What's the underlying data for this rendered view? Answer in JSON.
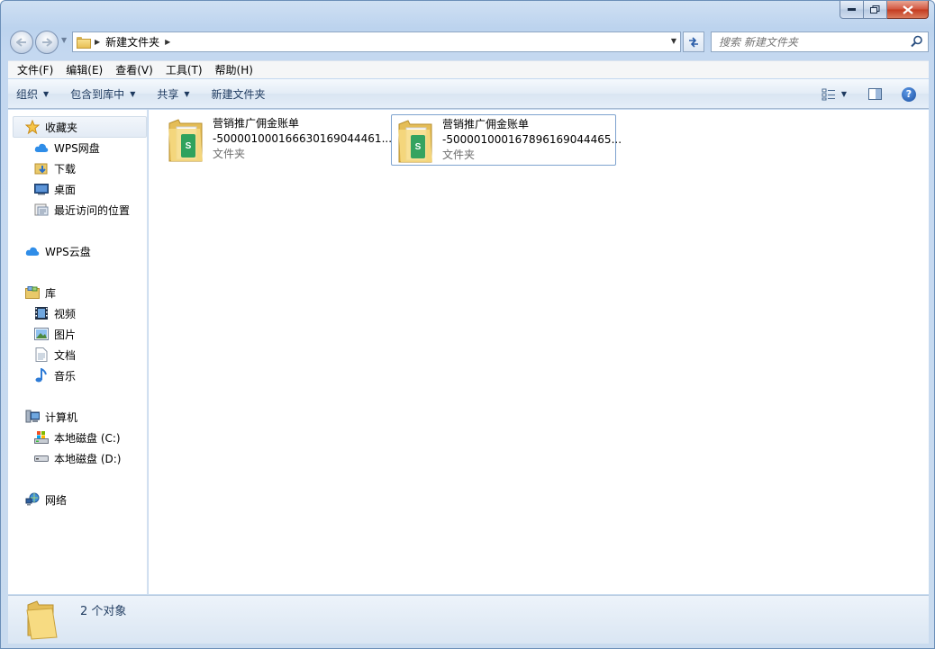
{
  "window": {
    "caption": {
      "minimize": "—",
      "maximize": "□",
      "close": "✕"
    }
  },
  "address": {
    "path": [
      "新建文件夹"
    ],
    "search_placeholder": "搜索 新建文件夹"
  },
  "menu": [
    "文件(F)",
    "编辑(E)",
    "查看(V)",
    "工具(T)",
    "帮助(H)"
  ],
  "commands": [
    "组织",
    "包含到库中",
    "共享",
    "新建文件夹"
  ],
  "nav": {
    "favorites": {
      "label": "收藏夹",
      "items": [
        "WPS网盘",
        "下载",
        "桌面",
        "最近访问的位置"
      ]
    },
    "cloud": {
      "label": "WPS云盘"
    },
    "libraries": {
      "label": "库",
      "items": [
        "视频",
        "图片",
        "文档",
        "音乐"
      ]
    },
    "computer": {
      "label": "计算机",
      "items": [
        "本地磁盘 (C:)",
        "本地磁盘 (D:)"
      ]
    },
    "network": {
      "label": "网络"
    }
  },
  "files": [
    {
      "name_line1": "营销推广佣金账单",
      "name_line2": "-500001000166630169044461...",
      "type": "文件夹",
      "selected": false
    },
    {
      "name_line1": "营销推广佣金账单",
      "name_line2": "-500001000167896169044465...",
      "type": "文件夹",
      "selected": true
    }
  ],
  "status": {
    "count_text": "2 个对象"
  },
  "icons": {
    "folder": "folder-icon",
    "star": "star-icon",
    "cloud": "cloud-icon",
    "help": "help-icon"
  },
  "colors": {
    "accent": "#2a5da8",
    "selection_border": "#7da2ce",
    "spreadsheet_green": "#1e9c5a"
  }
}
